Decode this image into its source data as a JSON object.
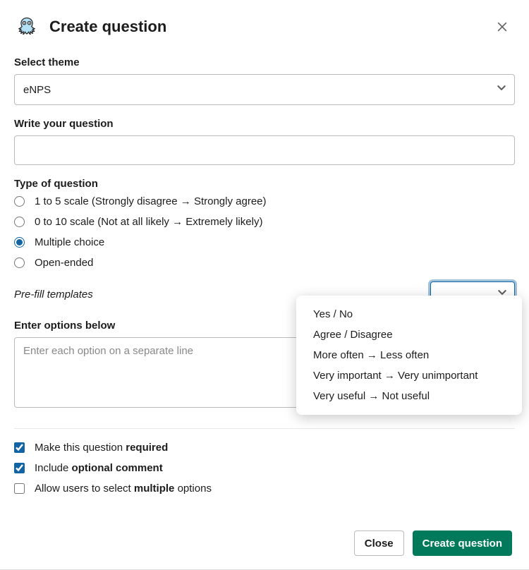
{
  "header": {
    "title": "Create question"
  },
  "theme": {
    "label": "Select theme",
    "selected": "eNPS"
  },
  "question": {
    "label": "Write your question",
    "value": ""
  },
  "typeOfQuestion": {
    "label": "Type of question",
    "options": [
      {
        "label": "1 to 5 scale (Strongly disagree → Strongly agree)",
        "selected": false
      },
      {
        "label": "0 to 10 scale (Not at all likely → Extremely likely)",
        "selected": false
      },
      {
        "label": "Multiple choice",
        "selected": true
      },
      {
        "label": "Open-ended",
        "selected": false
      }
    ]
  },
  "prefill": {
    "label": "Pre-fill templates",
    "dropdown_open": true,
    "options": [
      "Yes / No",
      "Agree / Disagree",
      "More often → Less often",
      "Very important → Very unimportant",
      "Very useful → Not useful"
    ]
  },
  "optionsField": {
    "label": "Enter options below",
    "placeholder": "Enter each option on a separate line",
    "value": ""
  },
  "checkboxes": {
    "required": {
      "prefix": "Make this question ",
      "bold": "required",
      "checked": true
    },
    "optionalComment": {
      "prefix": "Include ",
      "bold": "optional comment",
      "checked": true
    },
    "multiple": {
      "prefix": "Allow users to select ",
      "bold": "multiple",
      "suffix": " options",
      "checked": false
    }
  },
  "footer": {
    "close": "Close",
    "create": "Create question"
  }
}
